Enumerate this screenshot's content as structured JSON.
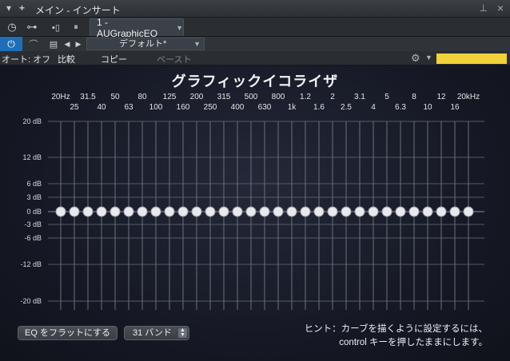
{
  "window": {
    "title": "メイン - インサート"
  },
  "toolbar1": {
    "plugin_tab": "1 - AUGraphicEQ"
  },
  "toolbar2": {
    "preset": "デフォルト*"
  },
  "toolbar3": {
    "auto": "オート: オフ",
    "compare": "比較",
    "copy": "コピー",
    "paste": "ペースト",
    "swatch_color": "#f1d23a"
  },
  "eq": {
    "title": "グラフィックイコライザ",
    "top_freqs": [
      "20Hz",
      "31.5",
      "50",
      "80",
      "125",
      "200",
      "315",
      "500",
      "800",
      "1.2",
      "2",
      "3.1",
      "5",
      "8",
      "12",
      "20kHz"
    ],
    "bottom_freqs": [
      "25",
      "40",
      "63",
      "100",
      "160",
      "250",
      "400",
      "630",
      "1k",
      "1.6",
      "2.5",
      "4",
      "6.3",
      "10",
      "16"
    ],
    "db_labels": [
      "20 dB",
      "12 dB",
      "6 dB",
      "3 dB",
      "0 dB",
      "-3 dB",
      "-6 dB",
      "-12 dB",
      "-20 dB"
    ],
    "band_count": 31,
    "band_gains_db": [
      0,
      0,
      0,
      0,
      0,
      0,
      0,
      0,
      0,
      0,
      0,
      0,
      0,
      0,
      0,
      0,
      0,
      0,
      0,
      0,
      0,
      0,
      0,
      0,
      0,
      0,
      0,
      0,
      0,
      0,
      0
    ],
    "flat_button": "EQ をフラットにする",
    "bands_select": "31 バンド",
    "hint_line1": "ヒント：カーブを描くように設定するには、",
    "hint_line2": "control キーを押したままにします。"
  }
}
